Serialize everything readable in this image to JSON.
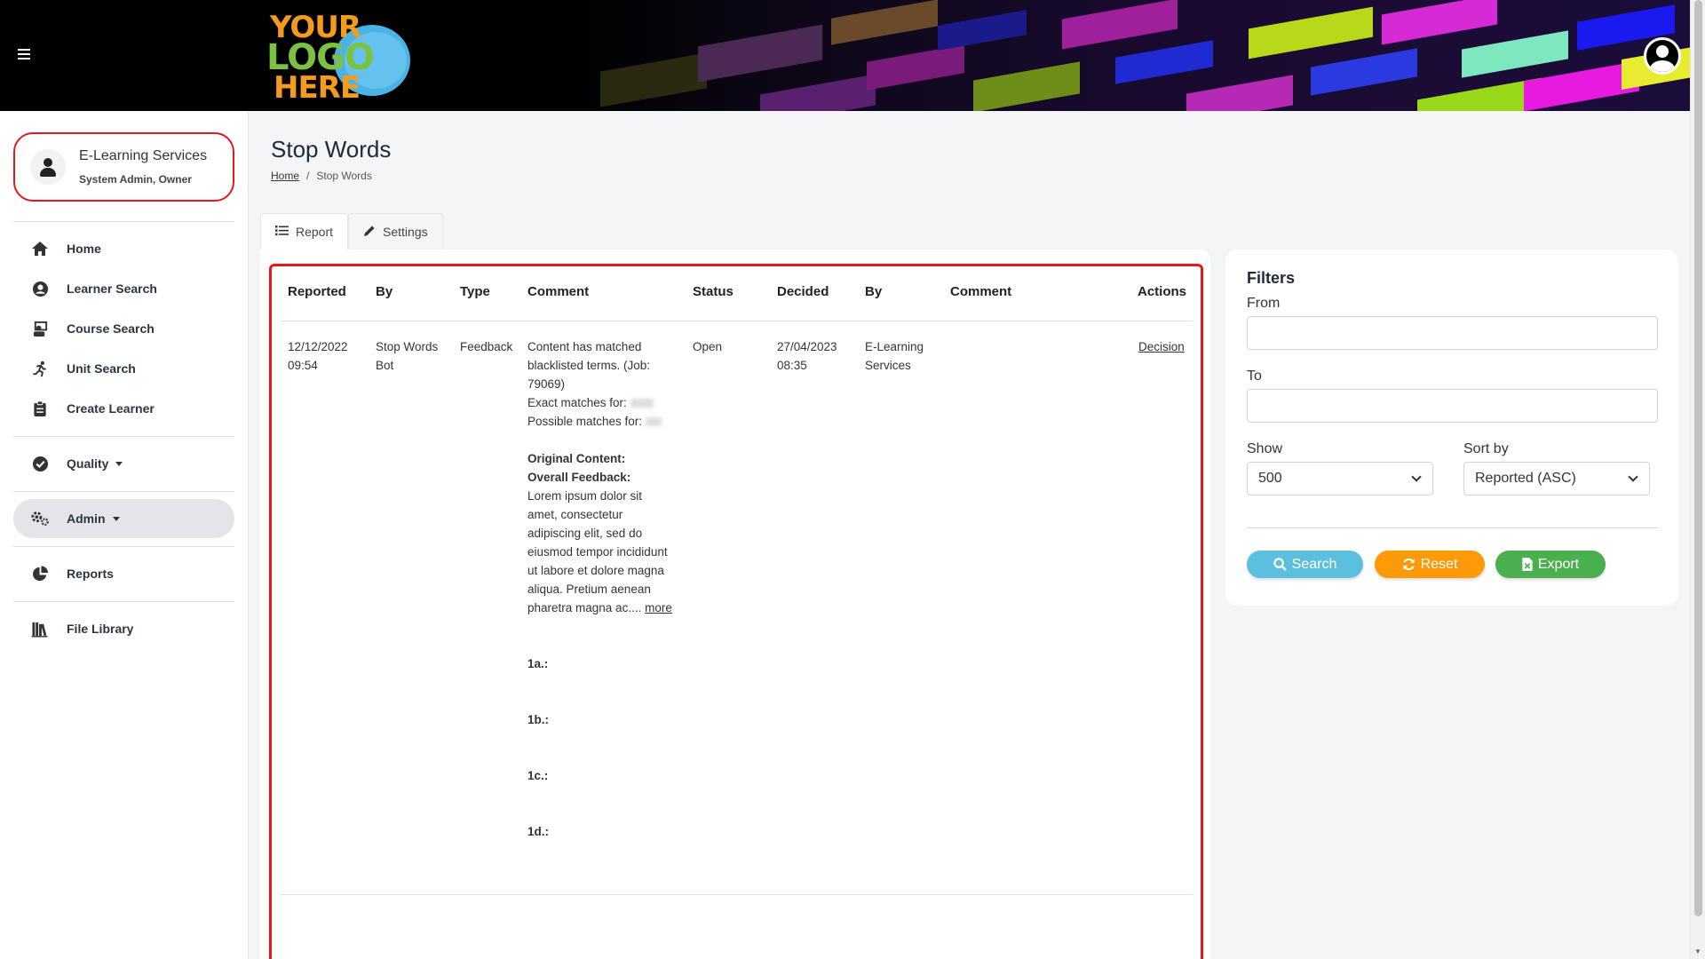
{
  "header": {
    "logo": {
      "line1": "YOUR",
      "line2": "LOGO",
      "line3": "HERE"
    }
  },
  "sidebar": {
    "user": {
      "name": "E-Learning Services",
      "role": "System Admin, Owner"
    },
    "items": [
      {
        "label": "Home",
        "icon": "home-icon"
      },
      {
        "label": "Learner Search",
        "icon": "user-circle-icon"
      },
      {
        "label": "Course Search",
        "icon": "teacher-icon"
      },
      {
        "label": "Unit Search",
        "icon": "running-person-icon"
      },
      {
        "label": "Create Learner",
        "icon": "clipboard-icon"
      },
      {
        "label": "Quality",
        "icon": "check-circle-icon"
      },
      {
        "label": "Admin",
        "icon": "cogs-icon"
      },
      {
        "label": "Reports",
        "icon": "pie-chart-icon"
      },
      {
        "label": "File Library",
        "icon": "books-icon"
      }
    ]
  },
  "page": {
    "title": "Stop Words",
    "breadcrumb": {
      "home": "Home",
      "separator": "/",
      "current": "Stop Words"
    }
  },
  "tabs": [
    {
      "label": "Report",
      "icon": "list-icon",
      "active": true
    },
    {
      "label": "Settings",
      "icon": "pencil-icon",
      "active": false
    }
  ],
  "table": {
    "columns": [
      "Reported",
      "By",
      "Type",
      "Comment",
      "Status",
      "Decided",
      "By",
      "Comment",
      "Actions"
    ],
    "row": {
      "reported_date": "12/12/2022",
      "reported_time": "09:54",
      "by_line1": "Stop Words",
      "by_line2": "Bot",
      "type": "Feedback",
      "comment": {
        "line1": "Content has matched",
        "line2": "blacklisted terms. (Job:",
        "line3": "79069)",
        "exact": "Exact matches for:",
        "possible": "Possible matches for:",
        "original_content": "Original Content:",
        "overall_feedback": "Overall Feedback:",
        "body": [
          "Lorem ipsum dolor sit",
          "amet, consectetur",
          "adipiscing elit, sed do",
          "eiusmod tempor incididunt",
          "ut labore et dolore magna",
          "aliqua. Pretium aenean",
          "pharetra magna ac...."
        ],
        "more": "more",
        "q1a": "1a.:",
        "q1b": "1b.:",
        "q1c": "1c.:",
        "q1d": "1d.:"
      },
      "status": "Open",
      "decided_date": "27/04/2023",
      "decided_time": "08:35",
      "decided_by_line1": "E-Learning",
      "decided_by_line2": "Services",
      "decided_comment": "",
      "action": "Decision"
    }
  },
  "filters": {
    "title": "Filters",
    "from_label": "From",
    "from_value": "",
    "to_label": "To",
    "to_value": "",
    "show_label": "Show",
    "show_value": "500",
    "sort_label": "Sort by",
    "sort_value": "Reported (ASC)",
    "search_button": "Search",
    "reset_button": "Reset",
    "export_button": "Export",
    "colors": {
      "search": "#5bc0de",
      "reset": "#fd9a0a",
      "export": "#49b04d"
    }
  }
}
